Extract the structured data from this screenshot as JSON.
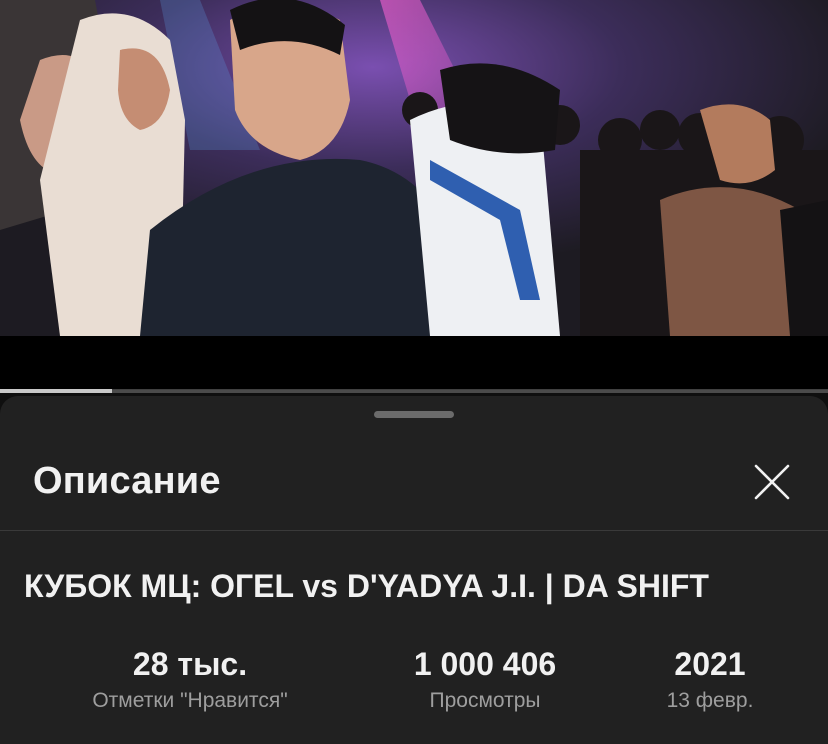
{
  "player": {
    "progress_fraction": 0.135
  },
  "sheet": {
    "title": "Описание",
    "close_icon": "close-icon"
  },
  "video": {
    "title": "КУБОК МЦ: OГEL vs D'YADYA J.I. | DA SHIFT"
  },
  "stats": {
    "likes_value": "28 тыс.",
    "likes_label": "Отметки \"Нравится\"",
    "views_value": "1 000 406",
    "views_label": "Просмотры",
    "year_value": "2021",
    "date_label": "13 февр."
  },
  "colors": {
    "sheet_bg": "#212121",
    "page_bg": "#0f0f0f",
    "secondary_text": "#9e9e9e",
    "primary_text": "#f1f1f1"
  }
}
